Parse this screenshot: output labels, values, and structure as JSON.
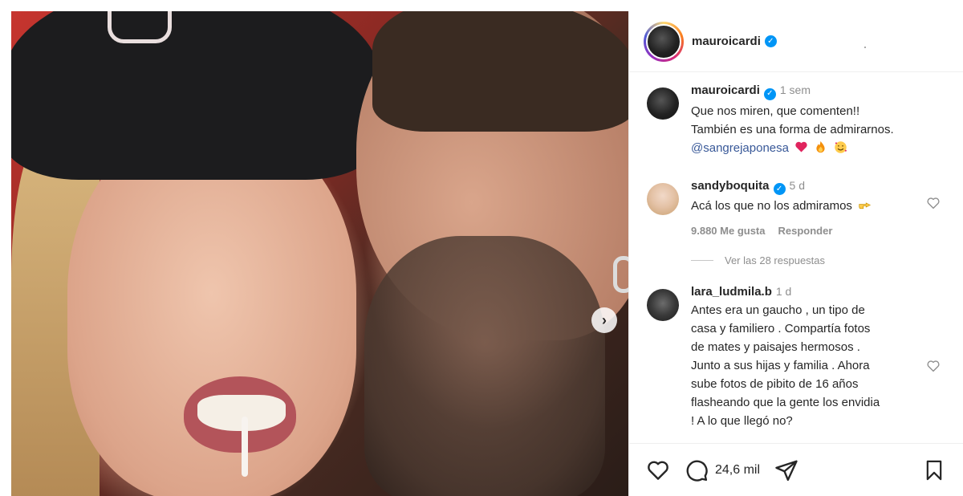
{
  "post": {
    "author": "mauroicardi",
    "verified": true,
    "caption": {
      "time": "1 sem",
      "line1": "Que nos miren, que comenten!!",
      "line2": "También es una forma de admirarnos.",
      "mention": "@sangrejaponesa",
      "emojis": [
        "heart-emoji",
        "fire-emoji",
        "smiling-hearts-emoji"
      ]
    }
  },
  "comments": [
    {
      "user": "sandyboquita",
      "verified": true,
      "time": "5 d",
      "text": "Acá los que no los admiramos",
      "emoji": "pointing-hand-emoji",
      "likes": "9.880 Me gusta",
      "reply_label": "Responder",
      "view_replies": "Ver las 28 respuestas"
    },
    {
      "user": "lara_ludmila.b",
      "verified": false,
      "time": "1 d",
      "text_lines": [
        "Antes era un gaucho , un tipo de",
        "casa y familiero . Compartía fotos",
        "de mates y paisajes hermosos .",
        "Junto a sus hijas y familia . Ahora",
        "sube fotos de pibito de 16 años",
        "flasheando que la gente los envidia",
        "! A lo que llegó no?"
      ]
    }
  ],
  "actions": {
    "comment_count": "24,6 mil"
  },
  "colors": {
    "verified_blue": "#0095f6",
    "mention": "#385898",
    "muted": "#8e8e8e"
  }
}
